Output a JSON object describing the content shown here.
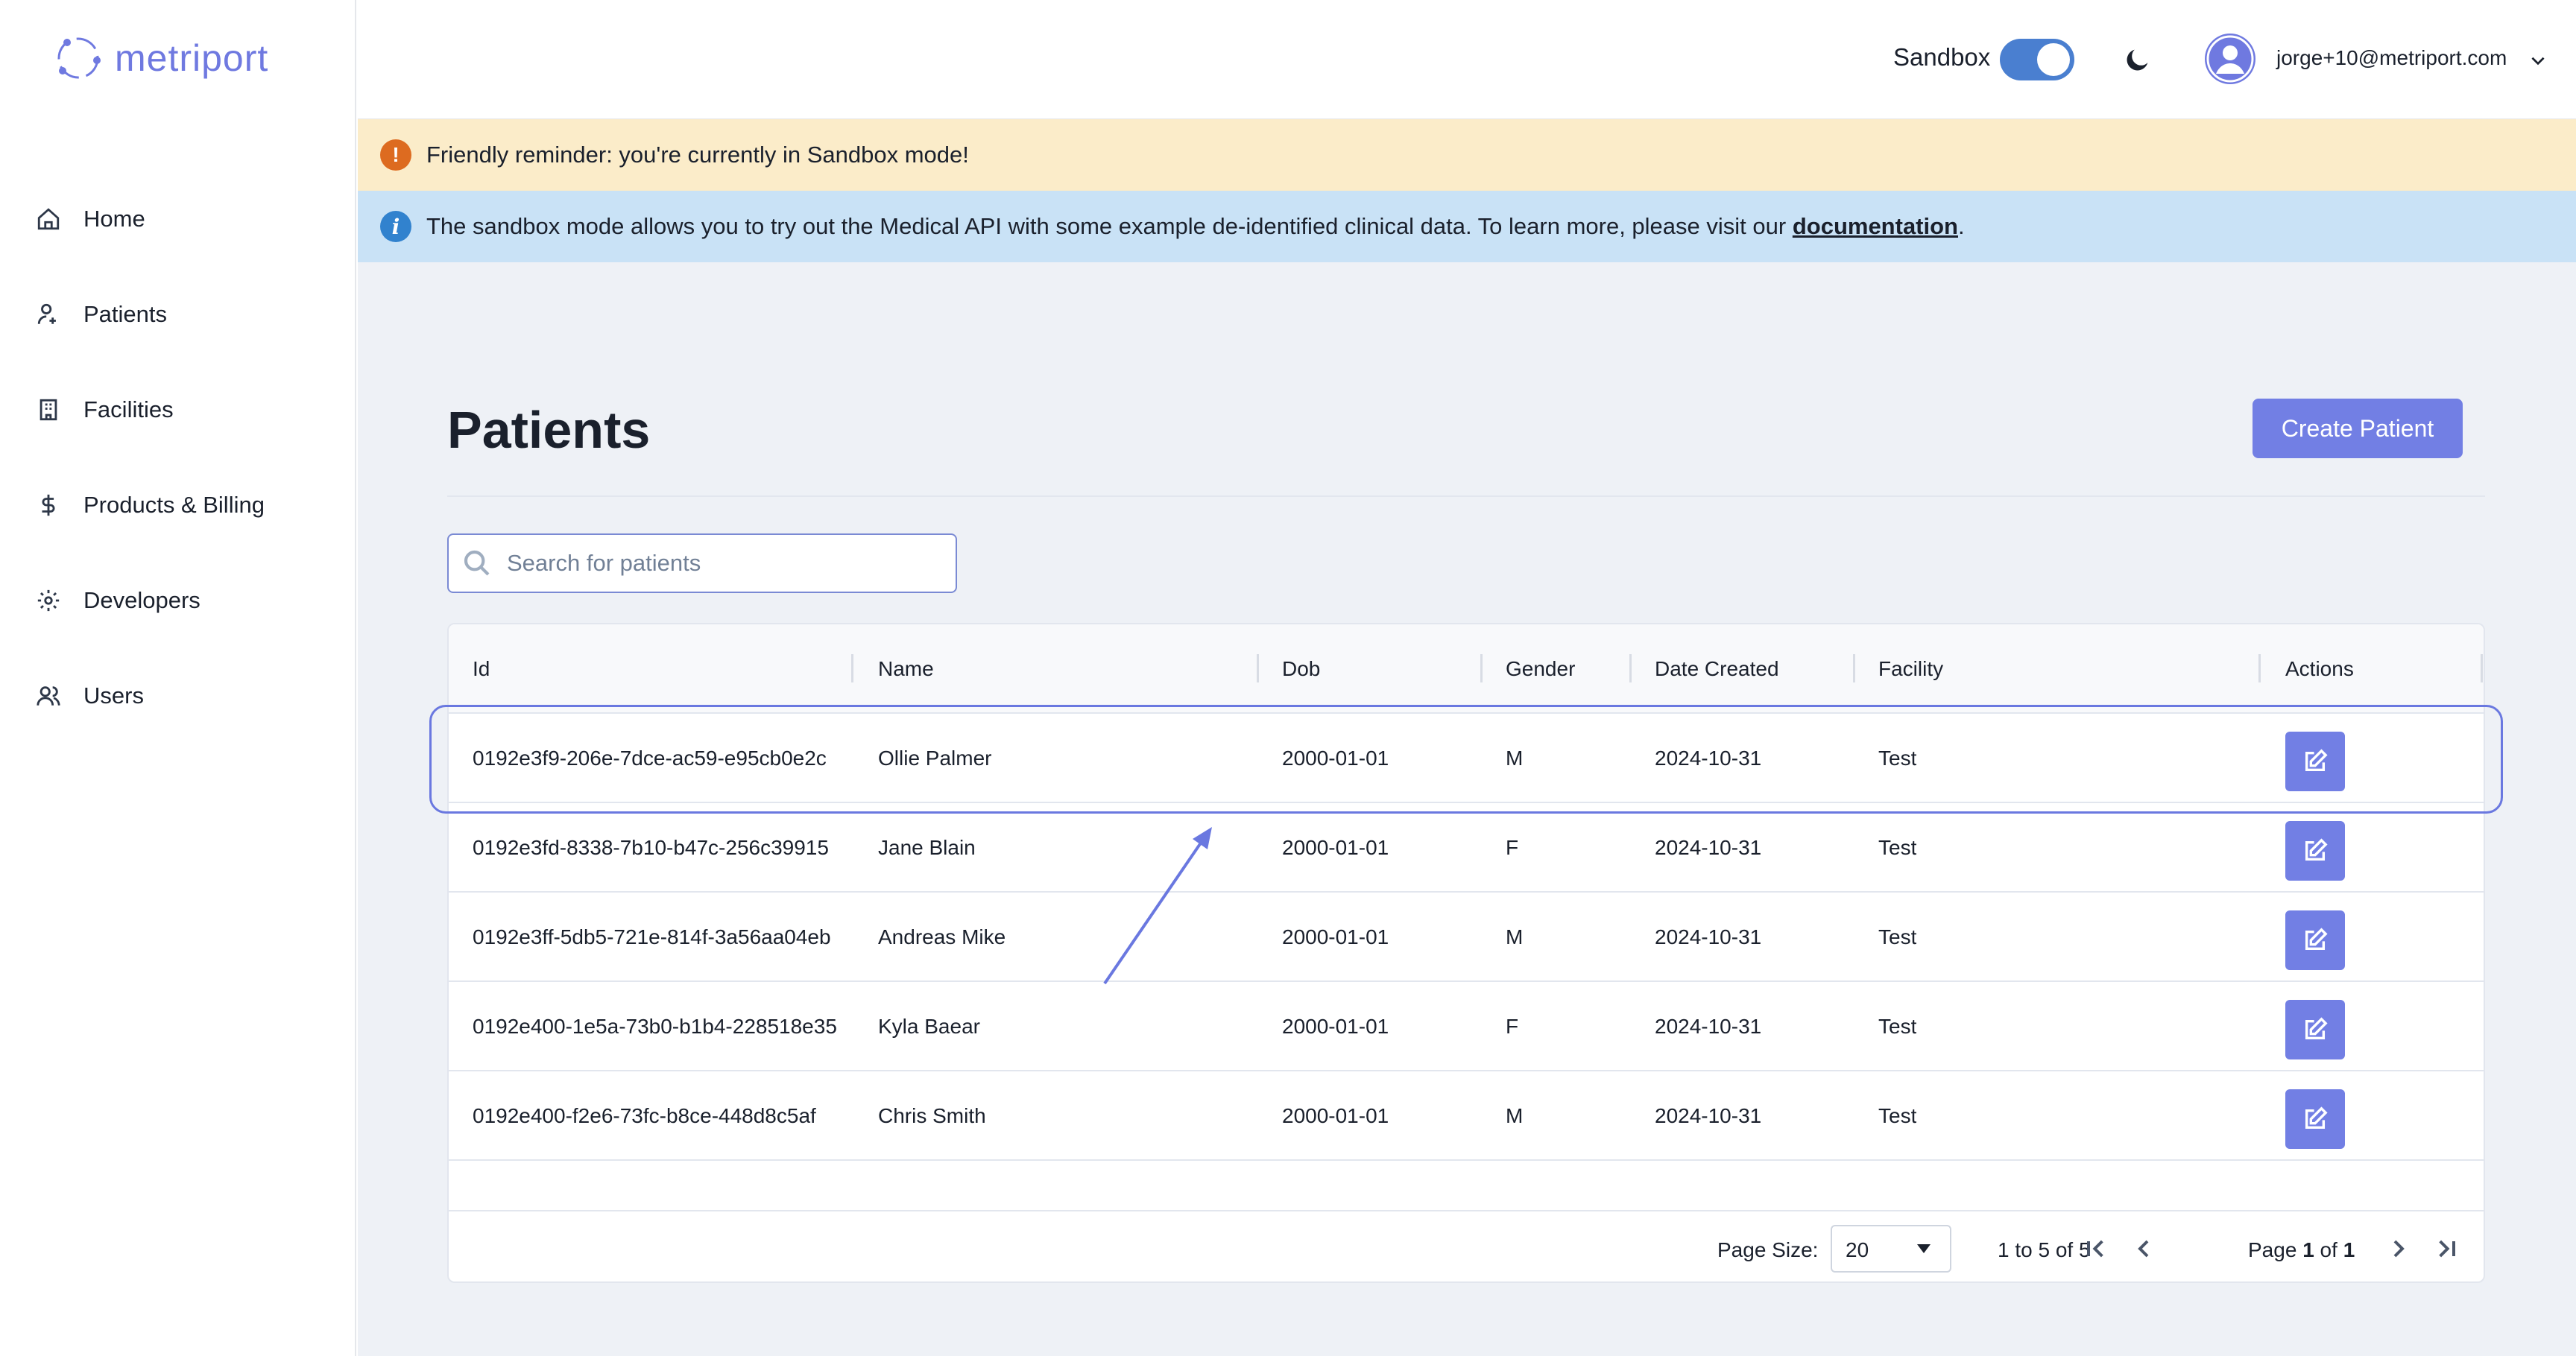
{
  "app": {
    "logo_text": "metriport"
  },
  "sidebar": {
    "items": [
      {
        "label": "Home",
        "icon": "home-icon"
      },
      {
        "label": "Patients",
        "icon": "patient-icon"
      },
      {
        "label": "Facilities",
        "icon": "building-icon"
      },
      {
        "label": "Products & Billing",
        "icon": "dollar-icon"
      },
      {
        "label": "Developers",
        "icon": "gear-icon"
      },
      {
        "label": "Users",
        "icon": "users-icon"
      }
    ]
  },
  "header": {
    "sandbox_label": "Sandbox",
    "sandbox_on": true,
    "user_email": "jorge+10@metriport.com"
  },
  "banners": {
    "warning_text": "Friendly reminder: you're currently in Sandbox mode!",
    "info_text": "The sandbox mode allows you to try out the Medical API with some example de-identified clinical data. To learn more, please visit our ",
    "info_link": "documentation",
    "info_suffix": "."
  },
  "page": {
    "title": "Patients",
    "create_button": "Create Patient",
    "search_placeholder": "Search for patients"
  },
  "table": {
    "columns": [
      "Id",
      "Name",
      "Dob",
      "Gender",
      "Date Created",
      "Facility",
      "Actions"
    ],
    "rows": [
      {
        "id": "0192e3f9-206e-7dce-ac59-e95cb0e2c",
        "name": "Ollie Palmer",
        "dob": "2000-01-01",
        "gender": "M",
        "created": "2024-10-31",
        "facility": "Test"
      },
      {
        "id": "0192e3fd-8338-7b10-b47c-256c39915",
        "name": "Jane Blain",
        "dob": "2000-01-01",
        "gender": "F",
        "created": "2024-10-31",
        "facility": "Test"
      },
      {
        "id": "0192e3ff-5db5-721e-814f-3a56aa04eb",
        "name": "Andreas Mike",
        "dob": "2000-01-01",
        "gender": "M",
        "created": "2024-10-31",
        "facility": "Test"
      },
      {
        "id": "0192e400-1e5a-73b0-b1b4-228518e35",
        "name": "Kyla Baear",
        "dob": "2000-01-01",
        "gender": "F",
        "created": "2024-10-31",
        "facility": "Test"
      },
      {
        "id": "0192e400-f2e6-73fc-b8ce-448d8c5af",
        "name": "Chris Smith",
        "dob": "2000-01-01",
        "gender": "M",
        "created": "2024-10-31",
        "facility": "Test"
      }
    ]
  },
  "pagination": {
    "page_size_label": "Page Size:",
    "page_size_value": "20",
    "range_text": "1 to 5 of 5",
    "page_word": "Page",
    "current_page": "1",
    "of_word": "of",
    "total_pages": "1"
  },
  "colors": {
    "accent": "#727fe4",
    "warning_bg": "#fbecc9",
    "info_bg": "#c9e2f6",
    "toggle_on": "#4a7fd0"
  }
}
